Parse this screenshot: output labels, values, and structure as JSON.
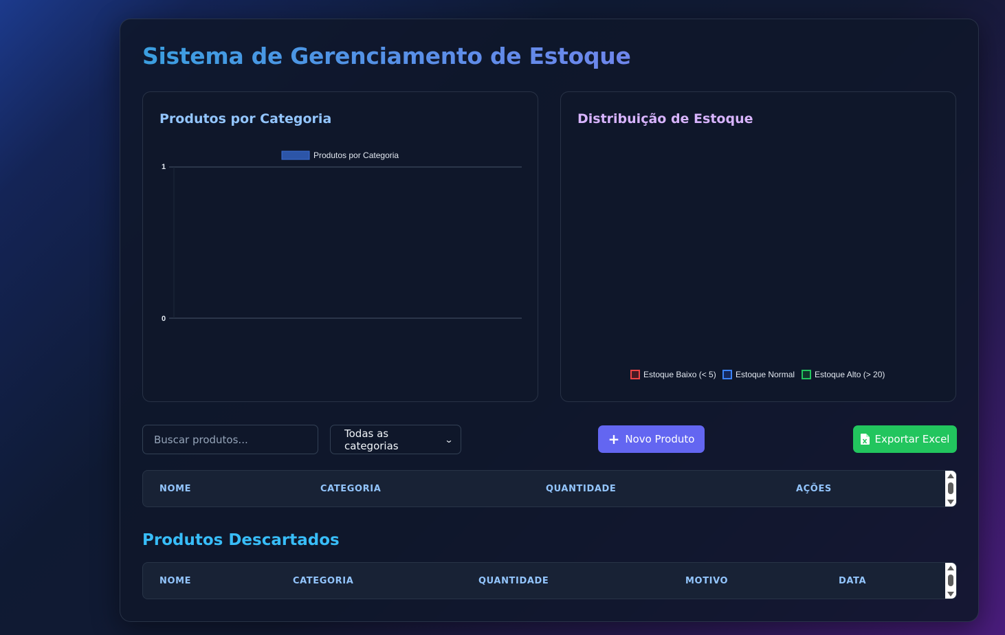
{
  "header": {
    "title": "Sistema de Gerenciamento de Estoque"
  },
  "charts": {
    "left": {
      "title": "Produtos por Categoria"
    },
    "right": {
      "title": "Distribuição de Estoque"
    }
  },
  "chart_data": [
    {
      "type": "bar",
      "title": "",
      "categories": [],
      "series": [
        {
          "name": "Produtos por Categoria",
          "values": [],
          "color": "#2c55a8"
        }
      ],
      "y_ticks": [
        "1",
        "0"
      ],
      "ylim": [
        0,
        1
      ],
      "grid": true,
      "legend": "top"
    },
    {
      "type": "pie",
      "title": "",
      "categories": [
        "Estoque Baixo (< 5)",
        "Estoque Normal",
        "Estoque Alto (> 20)"
      ],
      "values": [],
      "colors": [
        "#ef4444",
        "#3b82f6",
        "#22c55e"
      ],
      "legend": "bottom"
    }
  ],
  "toolbar": {
    "search_placeholder": "Buscar produtos...",
    "category_selected": "Todas as categorias",
    "new_button": "Novo Produto",
    "export_button": "Exportar Excel"
  },
  "products_table": {
    "columns": [
      "NOME",
      "CATEGORIA",
      "QUANTIDADE",
      "AÇÕES"
    ],
    "rows": []
  },
  "discarded": {
    "title": "Produtos Descartados",
    "columns": [
      "NOME",
      "CATEGORIA",
      "QUANTIDADE",
      "MOTIVO",
      "DATA"
    ],
    "rows": []
  },
  "colors": {
    "accent_purple": "#6366f1",
    "accent_green": "#22c55e",
    "header_blue": "#93c5fd",
    "section_title": "#38bdf8"
  }
}
